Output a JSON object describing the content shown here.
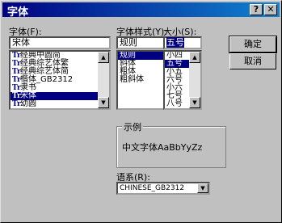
{
  "window": {
    "title": "字体",
    "help_btn": "?",
    "close_btn": "✕"
  },
  "font": {
    "label": "字体(F):",
    "value": "宋体",
    "items": [
      {
        "icon": "Tr",
        "text": "经典中圆简"
      },
      {
        "icon": "Tr",
        "text": "经典综艺体繁"
      },
      {
        "icon": "Tr",
        "text": "经典综艺体简"
      },
      {
        "icon": "Tr",
        "text": "楷体_GB2312"
      },
      {
        "icon": "Tr",
        "text": "隶书"
      },
      {
        "icon": "Tr",
        "text": "宋体"
      },
      {
        "icon": "Tr",
        "text": "幼圆"
      }
    ],
    "selected_index": 5
  },
  "style": {
    "label": "字体样式(Y):",
    "value": "规则",
    "items": [
      "规则",
      "斜体",
      "粗体",
      "粗斜体"
    ],
    "selected_index": 0
  },
  "size": {
    "label": "大小(S):",
    "value": "五号",
    "items": [
      "小四",
      "五号",
      "小五",
      "六号",
      "小六",
      "七号",
      "八号"
    ],
    "selected_index": 1
  },
  "buttons": {
    "ok": "确定",
    "cancel": "取消"
  },
  "sample": {
    "label": "示例",
    "text": "中文字体AaBbYyZz"
  },
  "script": {
    "label": "语系(R):",
    "value": "CHINESE_GB2312"
  },
  "scroll": {
    "up": "▲",
    "down": "▼",
    "dropdown": "▼"
  }
}
